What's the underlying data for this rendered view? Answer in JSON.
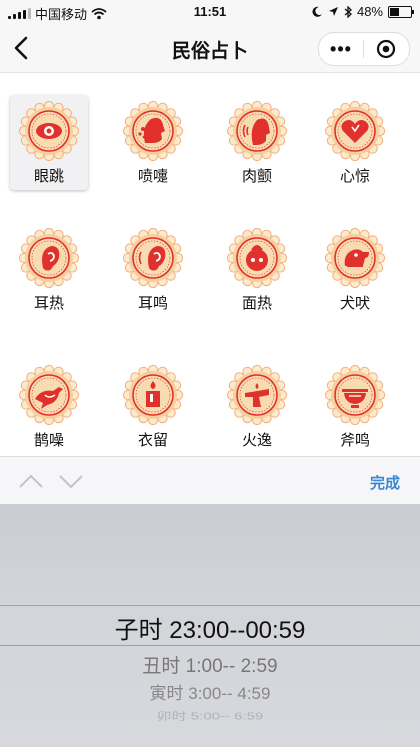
{
  "status": {
    "carrier": "中国移动",
    "time": "11:51",
    "battery": "48%",
    "battery_level": 0.48
  },
  "nav": {
    "title": "民俗占卜",
    "more": "•••"
  },
  "grid": {
    "items": [
      {
        "label": "眼跳",
        "icon": "eye-icon"
      },
      {
        "label": "喷嚏",
        "icon": "sneeze-icon"
      },
      {
        "label": "肉颤",
        "icon": "face-tremor-icon"
      },
      {
        "label": "心惊",
        "icon": "heart-icon"
      },
      {
        "label": "耳热",
        "icon": "ear-icon"
      },
      {
        "label": "耳鸣",
        "icon": "ear-ringing-icon"
      },
      {
        "label": "面热",
        "icon": "face-hot-icon"
      },
      {
        "label": "犬吠",
        "icon": "dog-icon"
      },
      {
        "label": "鹊噪",
        "icon": "magpie-icon"
      },
      {
        "label": "衣留",
        "icon": "candle-icon"
      },
      {
        "label": "火逸",
        "icon": "fire-escape-icon"
      },
      {
        "label": "斧鸣",
        "icon": "bowl-icon"
      }
    ]
  },
  "picker": {
    "done_label": "完成",
    "selected": "子时 23:00--00:59",
    "options": [
      "丑时 1:00-- 2:59",
      "寅时 3:00-- 4:59",
      "卯时 5:00-- 6:59"
    ]
  },
  "colors": {
    "accent_red": "#e0312c",
    "badge_bg": "#f6cf9e",
    "link_blue": "#3b87d3"
  }
}
